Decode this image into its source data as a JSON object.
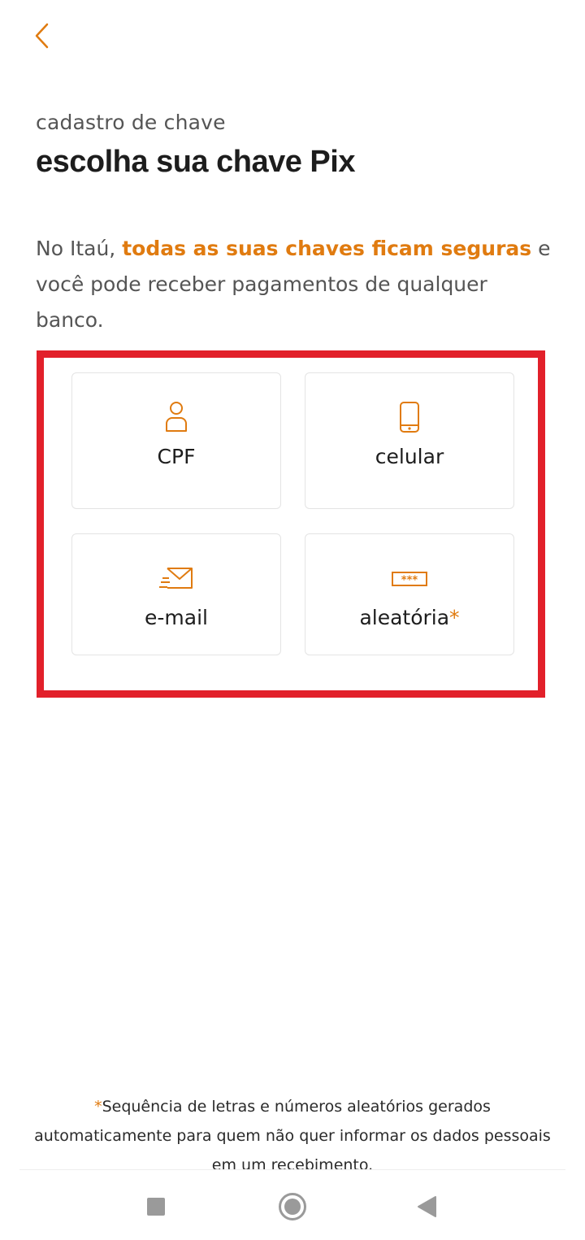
{
  "header": {
    "back_icon": "chevron-left-icon",
    "subtitle": "cadastro de chave",
    "title": "escolha sua chave Pix"
  },
  "description": {
    "prefix": "No Itaú, ",
    "highlight": "todas as suas chaves ficam seguras",
    "suffix": " e você pode receber pagamentos de qualquer banco."
  },
  "options": [
    {
      "id": "cpf",
      "label": "CPF",
      "icon": "person-icon"
    },
    {
      "id": "celular",
      "label": "celular",
      "icon": "phone-icon"
    },
    {
      "id": "email",
      "label": "e-mail",
      "icon": "envelope-icon"
    },
    {
      "id": "aleatoria",
      "label": "aleatória",
      "marker": "*",
      "icon": "password-field-icon"
    }
  ],
  "footnote": {
    "marker": "*",
    "text": "Sequência de letras e números aleatórios gerados automaticamente para quem não quer informar os dados pessoais em um recebimento."
  },
  "system_nav": {
    "recents_icon": "square-icon",
    "home_icon": "circle-home-icon",
    "back_icon": "triangle-back-icon"
  },
  "colors": {
    "accent": "#e07b10",
    "highlight_frame": "#e2202a",
    "text_primary": "#1d1d1d",
    "text_secondary": "#555555"
  }
}
